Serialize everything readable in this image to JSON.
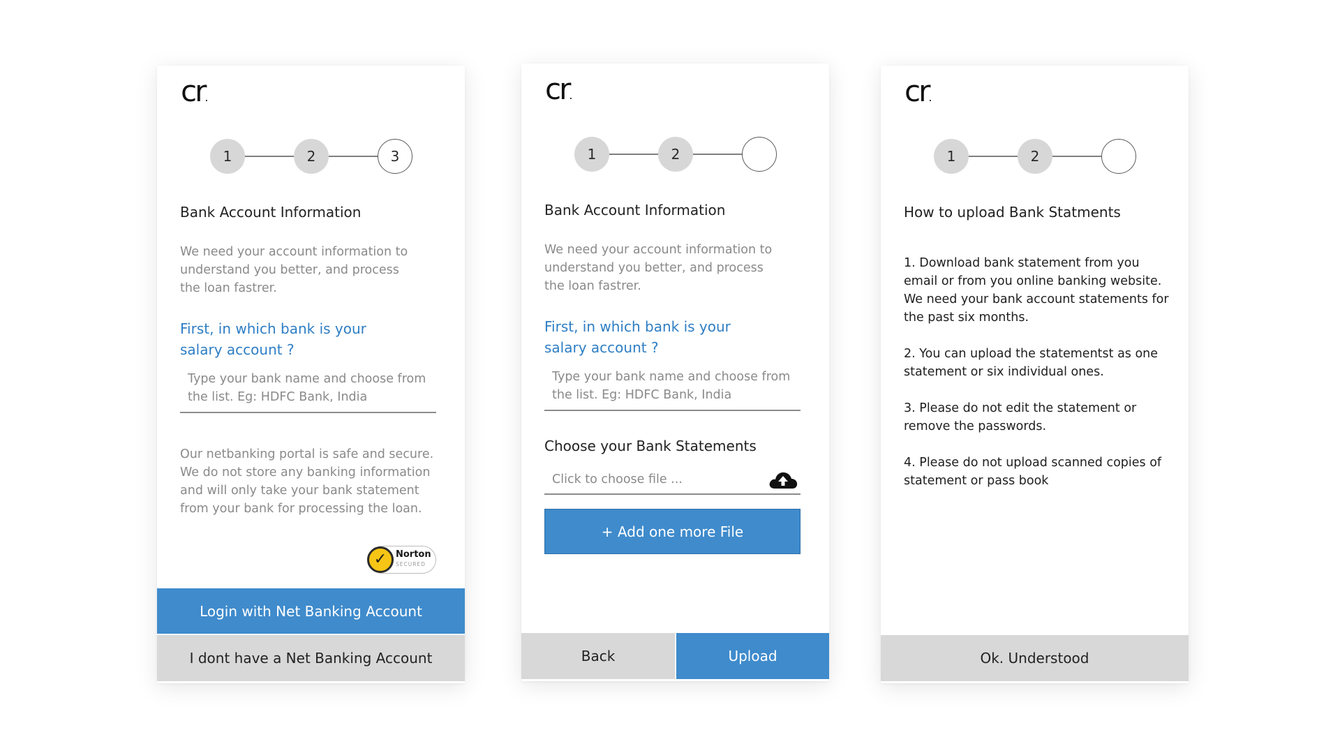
{
  "brand": {
    "logo_text": "cr",
    "logo_dot": "."
  },
  "colors": {
    "accent": "#3f8bcc",
    "link": "#2e7ec4",
    "step_done": "#d7d7d7",
    "button_gray": "#d8d8d8"
  },
  "screen1": {
    "steps": [
      "1",
      "2",
      "3"
    ],
    "title": "Bank Account Information",
    "description": "We need your account information to understand you better, and process the loan fastrer.",
    "question": "First, in which bank is your salary account ?",
    "bank_input_placeholder": "Type your bank name and choose from the list. Eg: HDFC Bank, India",
    "security_note": "Our netbanking portal is safe and secure. We do not store any banking information and will only take your bank statement from your bank for processing the loan.",
    "badge": {
      "brand": "Norton",
      "sub": "SECURED"
    },
    "primary_button": "Login with Net Banking Account",
    "secondary_button": "I dont have a Net Banking Account"
  },
  "screen2": {
    "steps": [
      "1",
      "2",
      ""
    ],
    "title": "Bank Account Information",
    "description": "We need your account information to understand you better, and process the loan fastrer.",
    "question": "First, in which bank is your salary account ?",
    "bank_input_placeholder": "Type your bank name and choose from the list. Eg: HDFC Bank, India",
    "statements_title": "Choose your Bank Statements",
    "file_placeholder": "Click to choose file ...",
    "add_file_button": "+ Add one more File",
    "back_button": "Back",
    "upload_button": "Upload"
  },
  "screen3": {
    "steps": [
      "1",
      "2",
      ""
    ],
    "title": "How to upload Bank Statments",
    "instructions": [
      "1. Download bank statement from you email or from you online banking website. We need your bank account statements for the past six months.",
      "2. You can upload the statementst as one statement or six individual ones.",
      "3. Please do not edit the statement or remove the passwords.",
      "4. Please do not upload scanned copies of statement or pass book"
    ],
    "ok_button": "Ok. Understood"
  }
}
